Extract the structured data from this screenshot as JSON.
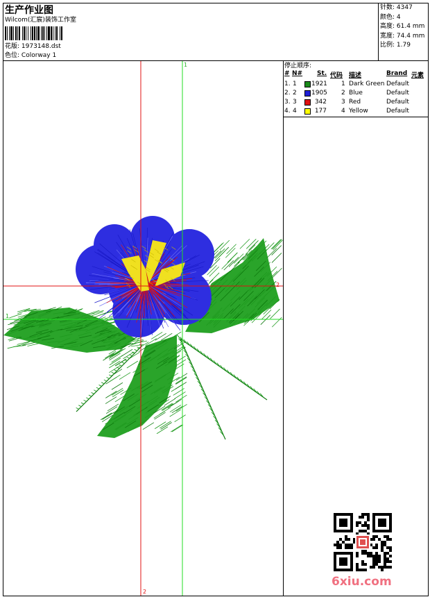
{
  "header": {
    "title": "生产作业图",
    "company": "Wilcom(汇宸)装饰工作室",
    "design_label": "花版:",
    "design_file": "1973148.dst",
    "colorway_label": "色位:",
    "colorway": "Colorway 1"
  },
  "stats": {
    "stitches_label": "针数:",
    "stitches": "4347",
    "colors_label": "颜色:",
    "colors": "4",
    "height_label": "高度:",
    "height": "61.4 mm",
    "width_label": "宽度:",
    "width": "74.4 mm",
    "scale_label": "比例:",
    "scale": "1.79"
  },
  "stop_sequence": {
    "title": "停止顺序:",
    "headers": [
      "#",
      "N#",
      "St.",
      "代码",
      "描述",
      "Brand",
      "元素"
    ],
    "rows": [
      {
        "num": "1.",
        "n": "1",
        "st": "1921",
        "code": "1",
        "desc": "Dark Green",
        "brand": "Default",
        "color": "#1a8a1a"
      },
      {
        "num": "2.",
        "n": "2",
        "st": "1905",
        "code": "2",
        "desc": "Blue",
        "brand": "Default",
        "color": "#1f1fd6"
      },
      {
        "num": "3.",
        "n": "3",
        "st": "342",
        "code": "3",
        "desc": "Red",
        "brand": "Default",
        "color": "#e01010"
      },
      {
        "num": "4.",
        "n": "4",
        "st": "177",
        "code": "4",
        "desc": "Yellow",
        "brand": "Default",
        "color": "#ffff00"
      }
    ]
  },
  "canvas": {
    "guide1_top": "1",
    "guide1_left": "1",
    "guide2_bottom": "2",
    "guide_red_right": "2"
  },
  "watermark": {
    "site": "6xiu.com"
  }
}
